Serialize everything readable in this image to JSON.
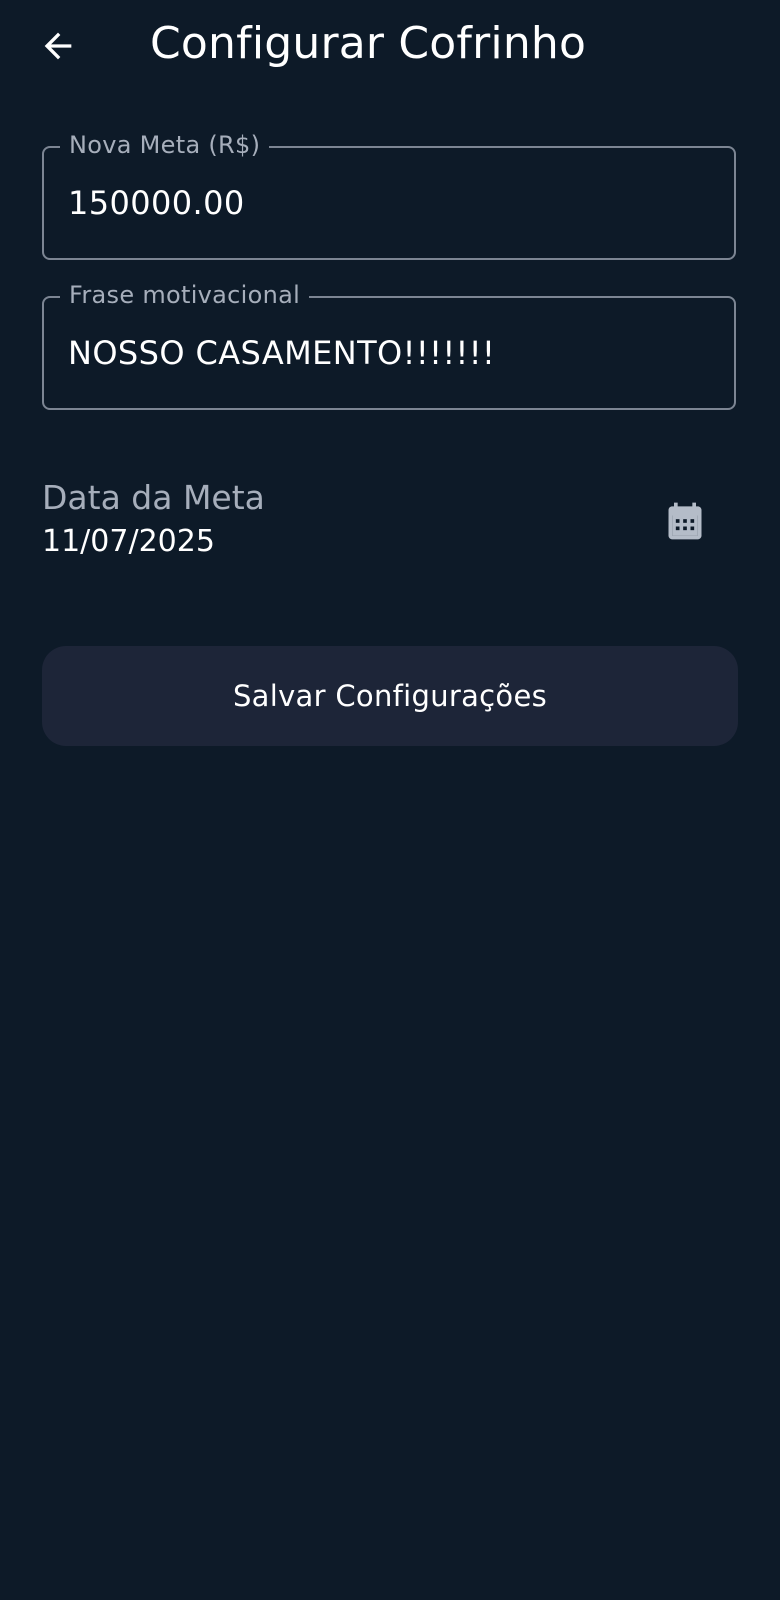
{
  "header": {
    "title": "Configurar Cofrinho",
    "back_icon": "arrow-back-icon"
  },
  "form": {
    "goal_amount": {
      "label": "Nova Meta (R$)",
      "value": "150000.00"
    },
    "motivational_phrase": {
      "label": "Frase motivacional",
      "value": "NOSSO CASAMENTO!!!!!!!"
    },
    "goal_date": {
      "label": "Data da Meta",
      "value": "11/07/2025",
      "icon": "calendar-icon"
    },
    "save_label": "Salvar Configurações"
  },
  "colors": {
    "background": "#0d1a28",
    "field_border": "#7c8593",
    "label_text": "#a6aebb",
    "button_background": "#1d2538",
    "text": "#ffffff"
  }
}
